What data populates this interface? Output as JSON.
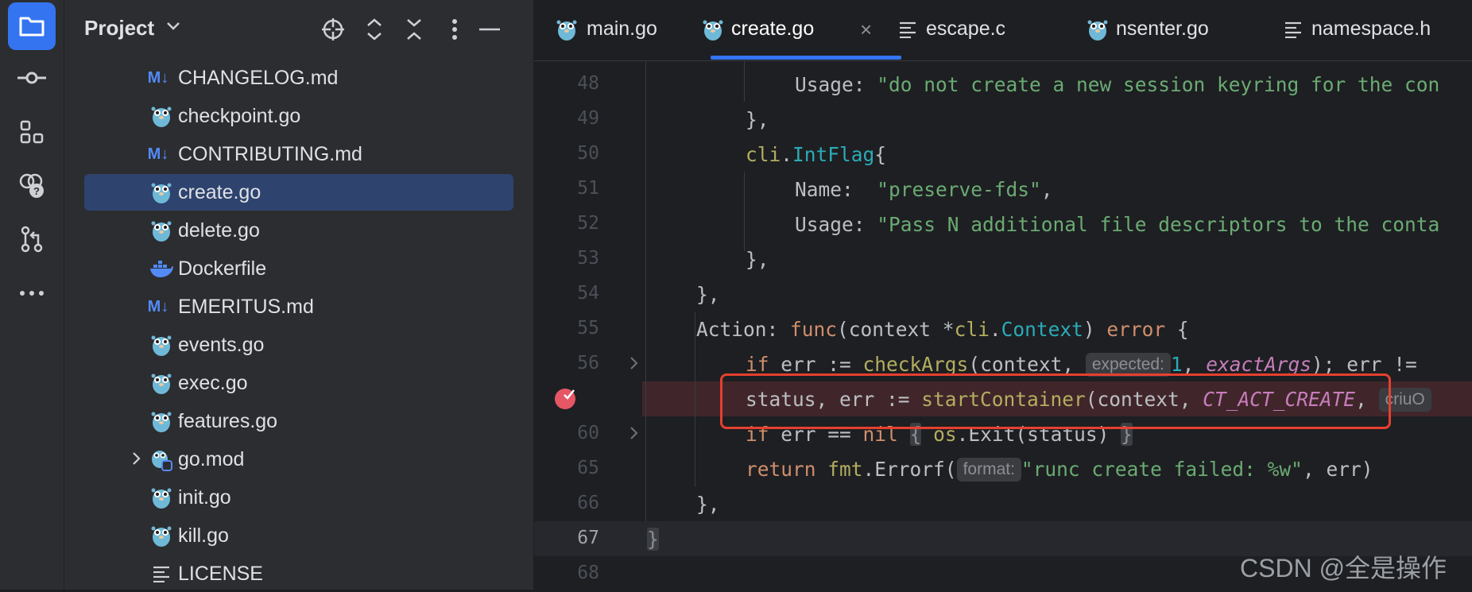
{
  "toolstrip": {
    "items": [
      {
        "name": "project-icon",
        "active": true
      },
      {
        "name": "commit-icon"
      },
      {
        "name": "structure-icon"
      },
      {
        "name": "services-icon"
      },
      {
        "name": "pull-requests-icon"
      },
      {
        "name": "more-icon"
      }
    ]
  },
  "project": {
    "title": "Project",
    "files": [
      {
        "label": "CHANGELOG.md",
        "icon": "markdown-icon"
      },
      {
        "label": "checkpoint.go",
        "icon": "go-file-icon"
      },
      {
        "label": "CONTRIBUTING.md",
        "icon": "markdown-icon"
      },
      {
        "label": "create.go",
        "icon": "go-file-icon",
        "selected": true
      },
      {
        "label": "delete.go",
        "icon": "go-file-icon"
      },
      {
        "label": "Dockerfile",
        "icon": "docker-icon"
      },
      {
        "label": "EMERITUS.md",
        "icon": "markdown-icon"
      },
      {
        "label": "events.go",
        "icon": "go-file-icon"
      },
      {
        "label": "exec.go",
        "icon": "go-file-icon"
      },
      {
        "label": "features.go",
        "icon": "go-file-icon"
      },
      {
        "label": "go.mod",
        "icon": "go-module-icon",
        "expandable": true
      },
      {
        "label": "init.go",
        "icon": "go-file-icon"
      },
      {
        "label": "kill.go",
        "icon": "go-file-icon"
      },
      {
        "label": "LICENSE",
        "icon": "text-file-icon"
      }
    ],
    "md_badge": "M↓"
  },
  "tabs": [
    {
      "label": "main.go",
      "icon": "go-file-icon"
    },
    {
      "label": "create.go",
      "icon": "go-file-icon",
      "active": true,
      "close": "×"
    },
    {
      "label": "escape.c",
      "icon": "text-file-icon"
    },
    {
      "label": "nsenter.go",
      "icon": "go-file-icon"
    },
    {
      "label": "namespace.h",
      "icon": "text-file-icon"
    }
  ],
  "gutter": {
    "line_numbers": [
      "48",
      "49",
      "50",
      "51",
      "52",
      "53",
      "54",
      "55",
      "56",
      "",
      "60",
      "65",
      "66",
      "67",
      "68"
    ],
    "current_line": "67"
  },
  "code": {
    "l48_key": "Usage:",
    "l48_str": "\"do not create a new session keyring for the con",
    "l49": "},",
    "l50_pkg": "cli",
    "l50_dot": ".",
    "l50_type": "IntFlag",
    "l50_brace": "{",
    "l51_key": "Name:",
    "l51_str": "\"preserve-fds\"",
    "l51_comma": ",",
    "l52_key": "Usage:",
    "l52_str": "\"Pass N additional file descriptors to the conta",
    "l53": "},",
    "l54": "},",
    "l55_field": "Action:",
    "l55_func": "func",
    "l55_params": "(context *",
    "l55_pkg": "cli",
    "l55_dot": ".",
    "l55_type": "Context",
    "l55_close": ")",
    "l55_err": "error",
    "l55_brace": "{",
    "l56_if": "if",
    "l56_mid": "err := ",
    "l56_fn": "checkArgs",
    "l56_args": "(context, ",
    "l56_hint": "expected:",
    "l56_num": "1",
    "l56_comma": ", ",
    "l56_const": "exactArgs",
    "l56_tail": "); err !=",
    "l57_vars": "status, err := ",
    "l57_fn": "startContainer",
    "l57_args": "(context, ",
    "l57_const": "CT_ACT_CREATE",
    "l57_comma": ", ",
    "l57_hint": "criuO",
    "l60_if": "if",
    "l60_mid": "err == ",
    "l60_nil": "nil",
    "l60_ob": "{",
    "l60_pkg": "os",
    "l60_call": ".Exit(status)",
    "l60_cb": "}",
    "l65_ret": "return",
    "l65_pkg": "fmt",
    "l65_call": ".Errorf(",
    "l65_hint": "format:",
    "l65_str": "\"runc create failed: %w\"",
    "l65_tail": ", err)",
    "l66": "},",
    "l67": "}"
  },
  "watermark": "CSDN @全是操作"
}
